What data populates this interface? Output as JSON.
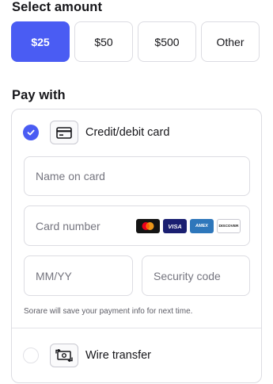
{
  "amount": {
    "title": "Select amount",
    "options": [
      {
        "label": "$25",
        "selected": true
      },
      {
        "label": "$50",
        "selected": false
      },
      {
        "label": "$500",
        "selected": false
      },
      {
        "label": "Other",
        "selected": false
      }
    ]
  },
  "pay": {
    "title": "Pay with",
    "card": {
      "label": "Credit/debit card",
      "icon": "credit-card-icon",
      "selected": true,
      "name_placeholder": "Name on card",
      "number_placeholder": "Card number",
      "expiry_placeholder": "MM/YY",
      "security_placeholder": "Security code",
      "brands": {
        "visa": "VISA",
        "amex": "AMEX",
        "discover": "DISCOVER"
      },
      "save_note": "Sorare will save your payment info for next time."
    },
    "wire": {
      "label": "Wire transfer",
      "icon": "banknote-transfer-icon",
      "selected": false
    }
  },
  "colors": {
    "accent": "#4a5cf3",
    "border": "#dcdce2"
  }
}
